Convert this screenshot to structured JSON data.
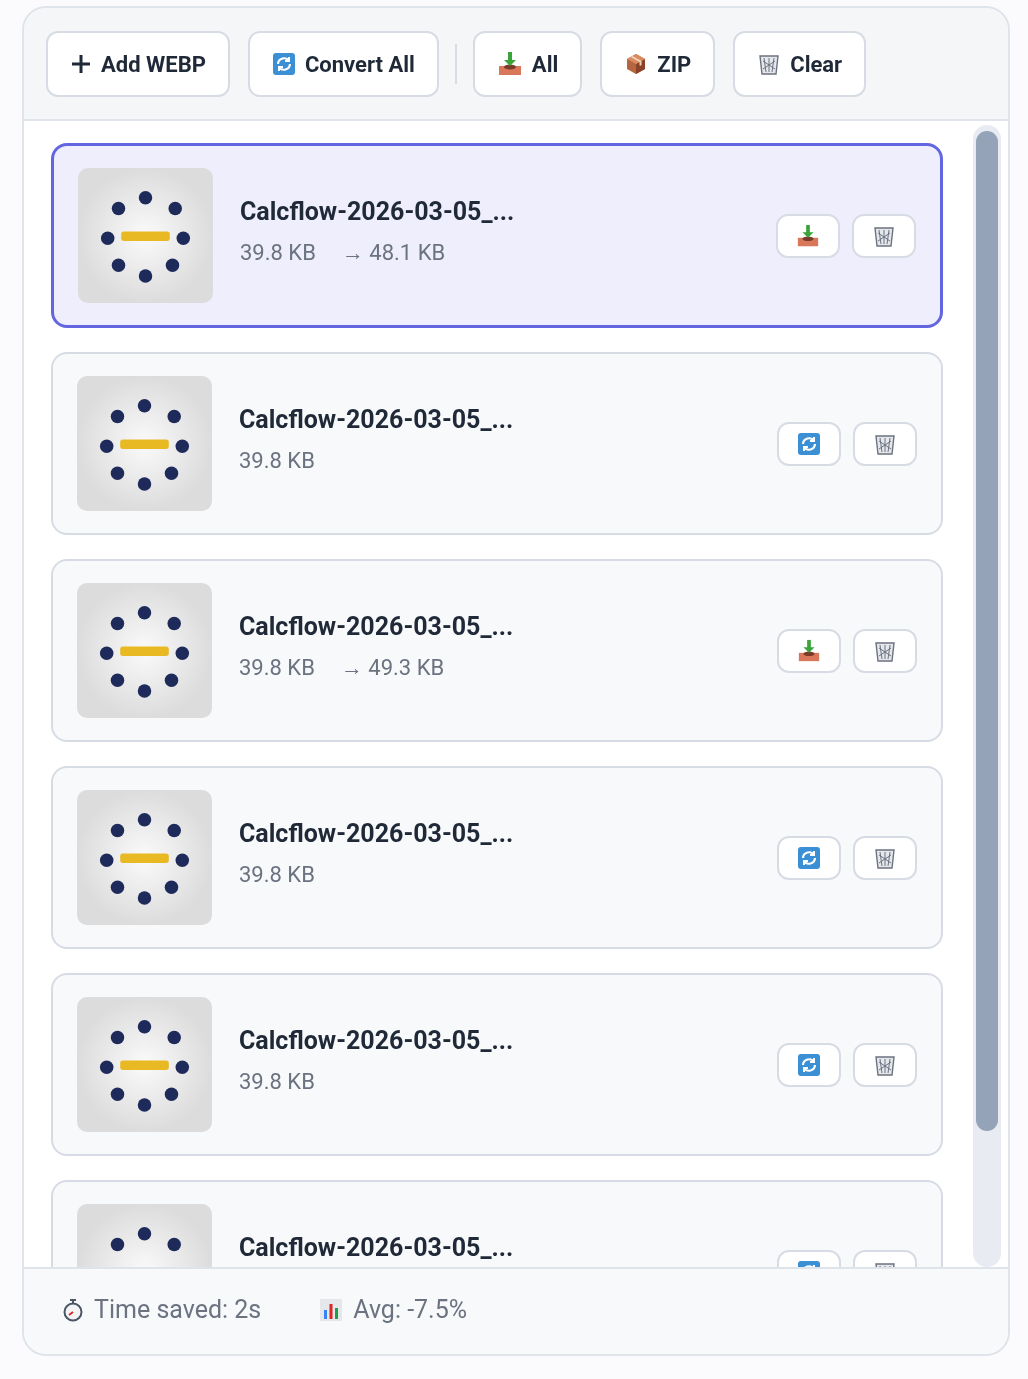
{
  "toolbar": {
    "buttons": [
      {
        "kind": "add",
        "label": "Add WEBP"
      },
      {
        "kind": "convert",
        "label": "Convert All"
      },
      {
        "kind": "download",
        "label": "All"
      },
      {
        "kind": "zip",
        "label": "ZIP"
      },
      {
        "kind": "clear",
        "label": "Clear"
      }
    ]
  },
  "files": [
    {
      "name": "Calcflow-2026-03-05_...",
      "size": "39.8 KB",
      "output_size": "→ 48.1 KB",
      "converted": true,
      "selected": true
    },
    {
      "name": "Calcflow-2026-03-05_...",
      "size": "39.8 KB",
      "converted": false,
      "selected": false
    },
    {
      "name": "Calcflow-2026-03-05_...",
      "size": "39.8 KB",
      "output_size": "→ 49.3 KB",
      "converted": true,
      "selected": false
    },
    {
      "name": "Calcflow-2026-03-05_...",
      "size": "39.8 KB",
      "converted": false,
      "selected": false
    },
    {
      "name": "Calcflow-2026-03-05_...",
      "size": "39.8 KB",
      "converted": false,
      "selected": false
    },
    {
      "name": "Calcflow-2026-03-05_...",
      "converted": false,
      "selected": false
    }
  ],
  "footer": {
    "time_saved": "Time saved: 2s",
    "average": "Avg: -7.5%"
  }
}
